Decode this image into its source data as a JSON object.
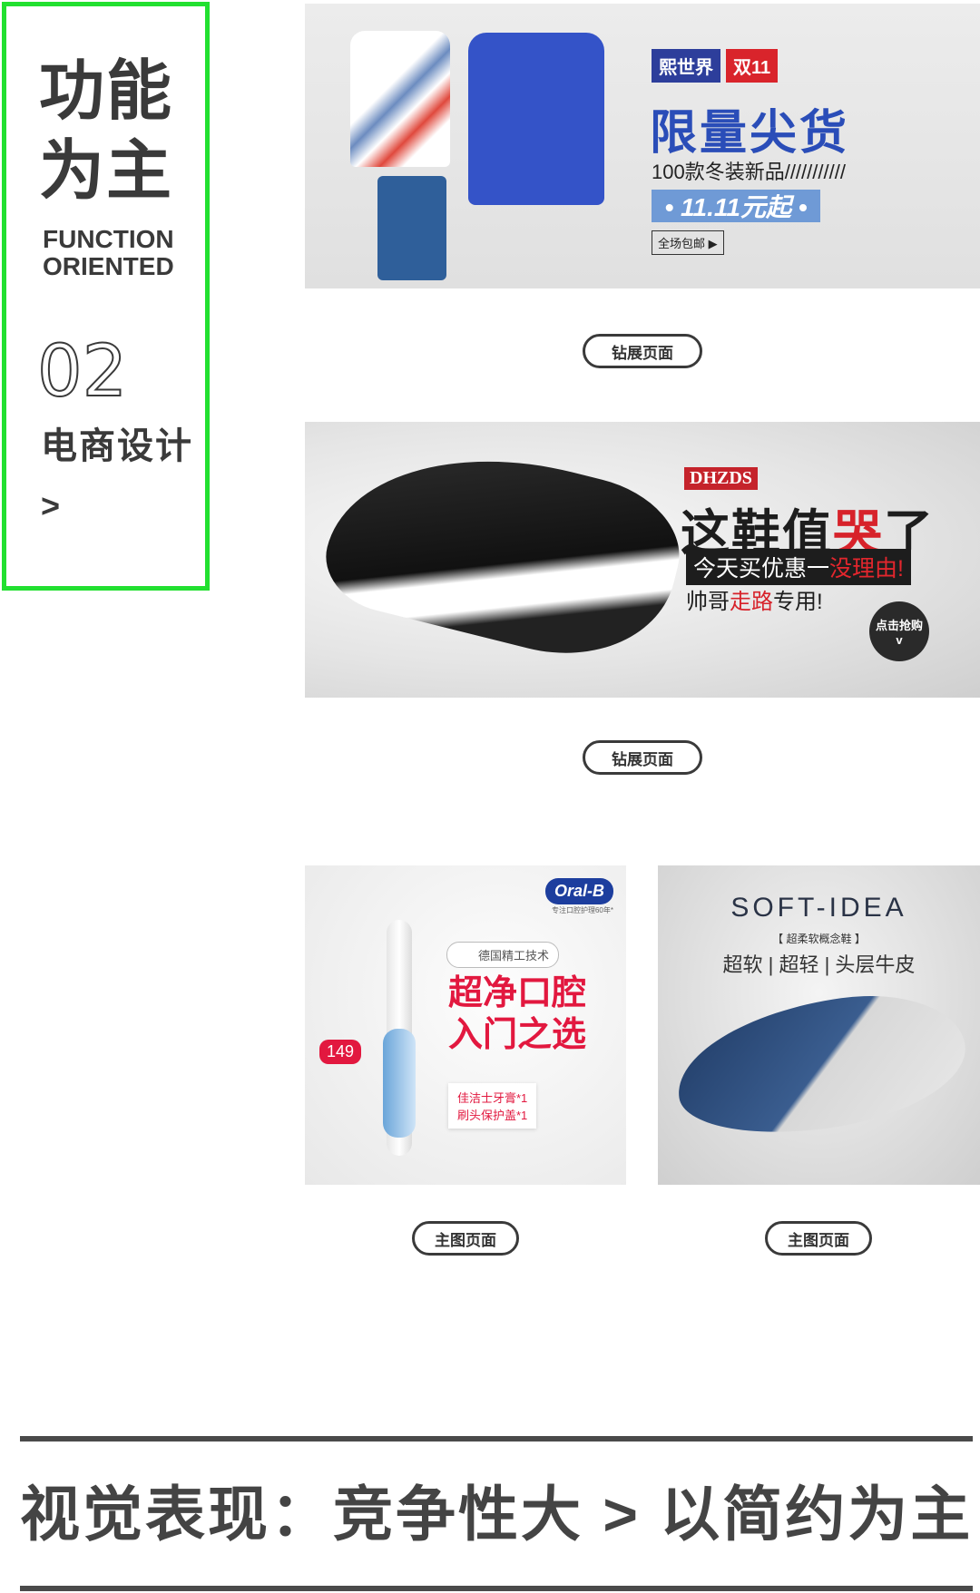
{
  "sidebar": {
    "title": "功能\n为主",
    "subtitle": "FUNCTION\nORIENTED",
    "number": "02",
    "category": "电商设计",
    "arrow": ">"
  },
  "banner1": {
    "brand": "熙世界",
    "sale": "双11",
    "title": "限量尖货",
    "subtitle": "100款冬装新品///////////",
    "price": "• 11.11元起 •",
    "shipping": "全场包邮 ▶"
  },
  "banner2": {
    "brand": "DHZDS",
    "title_part1": "这鞋值",
    "title_red": "哭",
    "title_part2": "了",
    "bar_text": "今天买优惠一",
    "bar_red": "没理由!",
    "small_part1": "帅哥",
    "small_red": "走路",
    "small_part2": "专用!",
    "buy": "点击抢购",
    "buy_chevron": "v"
  },
  "small1": {
    "logo": "Oral-B",
    "logo_sub": "专注口腔护理60年*",
    "badge": "德国精工技术",
    "headline": "超净口腔\n入门之选",
    "price": "149",
    "gift": "佳洁士牙膏*1\n刷头保护盖*1"
  },
  "small2": {
    "title": "SOFT-IDEA",
    "subtitle": "【 超柔软概念鞋 】",
    "features": "超软 | 超轻 | 头层牛皮"
  },
  "buttons": {
    "b1": "钻展页面",
    "b2": "钻展页面",
    "s1": "主图页面",
    "s2": "主图页面"
  },
  "footer": {
    "text": "视觉表现：竞争性大 > 以简约为主"
  },
  "colors": {
    "frame": "#22e030",
    "dark": "#3a3a3a",
    "red": "#d7222a",
    "blue": "#2a4db8"
  }
}
